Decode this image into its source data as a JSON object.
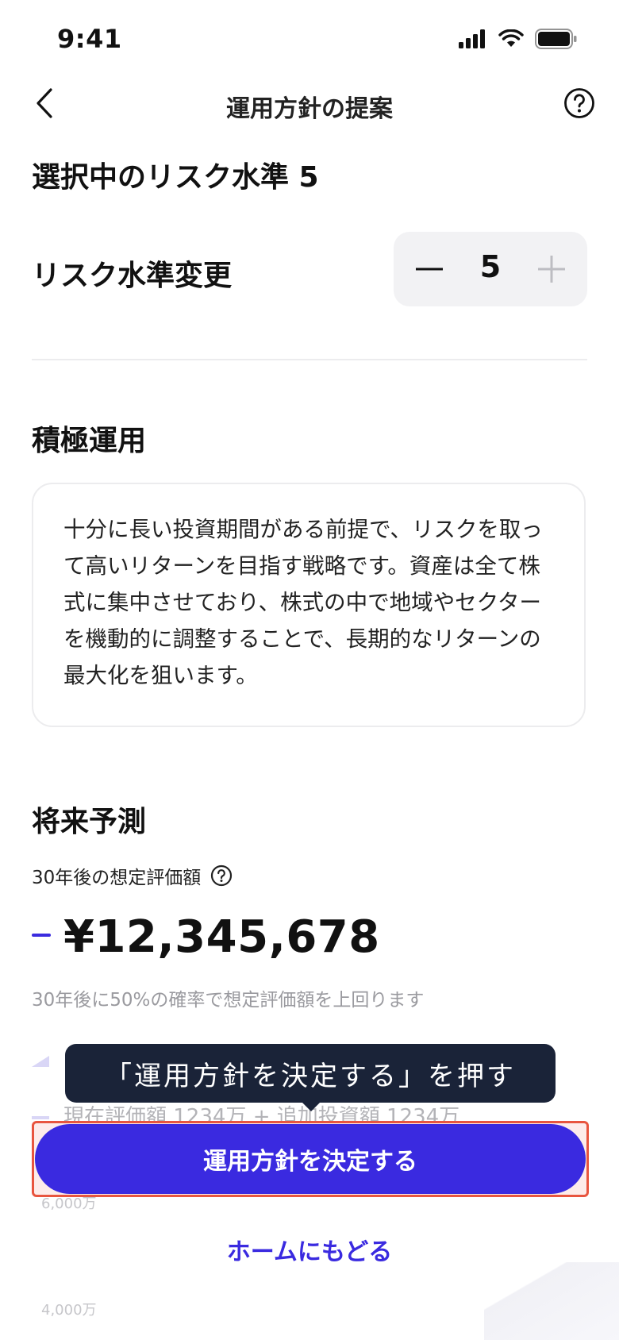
{
  "status_bar": {
    "time": "9:41"
  },
  "nav": {
    "title": "運用方針の提案"
  },
  "risk": {
    "selected_label": "選択中のリスク水準 5",
    "change_label": "リスク水準変更",
    "value": "5"
  },
  "policy": {
    "title": "積極運用",
    "description": "十分に長い投資期間がある前提で、リスクを取って高いリターンを目指す戦略です。資産は全て株式に集中させており、株式の中で地域やセクターを機動的に調整することで、長期的なリターンの最大化を狙います。"
  },
  "forecast": {
    "title": "将来予測",
    "subtitle": "30年後の想定評価額",
    "amount": "¥12,345,678",
    "probability_note": "30年後に50%の確率で想定評価額を上回ります",
    "legend_text": "現在評価額 1234万 + 追加投資額 1234万",
    "ticks": [
      "6,000万",
      "4,000万"
    ]
  },
  "tooltip": {
    "text": "「運用方針を決定する」を押す"
  },
  "actions": {
    "primary_label": "運用方針を決定する",
    "home_label": "ホームにもどる"
  },
  "colors": {
    "accent": "#3a2ae0",
    "tooltip_bg": "#1a2338",
    "highlight": "#e8553f"
  },
  "icons": {
    "back": "chevron-left-icon",
    "help": "question-circle-icon",
    "minus": "minus-icon",
    "plus": "plus-icon",
    "info": "question-circle-icon"
  }
}
